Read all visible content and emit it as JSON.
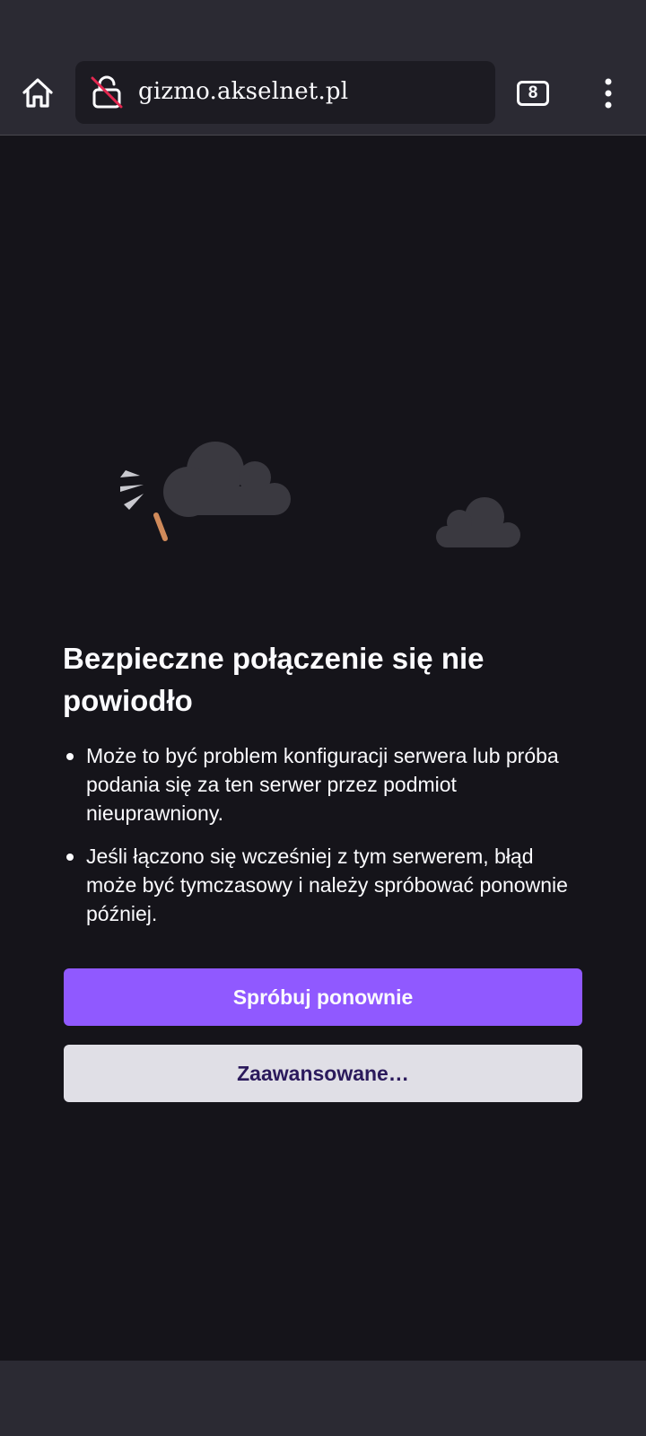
{
  "browser": {
    "url": "gizmo.akselnet.pl",
    "tab_count": "8",
    "icons": {
      "home": "home-icon",
      "lock": "broken-lock-icon",
      "menu": "more-vertical-icon"
    }
  },
  "error": {
    "title": "Bezpieczne połączenie się nie powiodło",
    "bullets": [
      "Może to być problem konfiguracji serwera lub próba podania się za ten serwer przez podmiot nieuprawniony.",
      "Jeśli łączono się wcześniej z tym serwerem, błąd może być tymczasowy i należy spróbować ponownie później."
    ],
    "retry_label": "Spróbuj ponownie",
    "advanced_label": "Zaawansowane…"
  },
  "colors": {
    "page_bg": "#15141a",
    "toolbar_bg": "#2b2a33",
    "primary_button": "#9059ff",
    "secondary_button": "#e0dfe6",
    "secondary_button_text": "#2b1a5c",
    "cloud": "#3a3940",
    "lock_slash": "#e22850"
  }
}
